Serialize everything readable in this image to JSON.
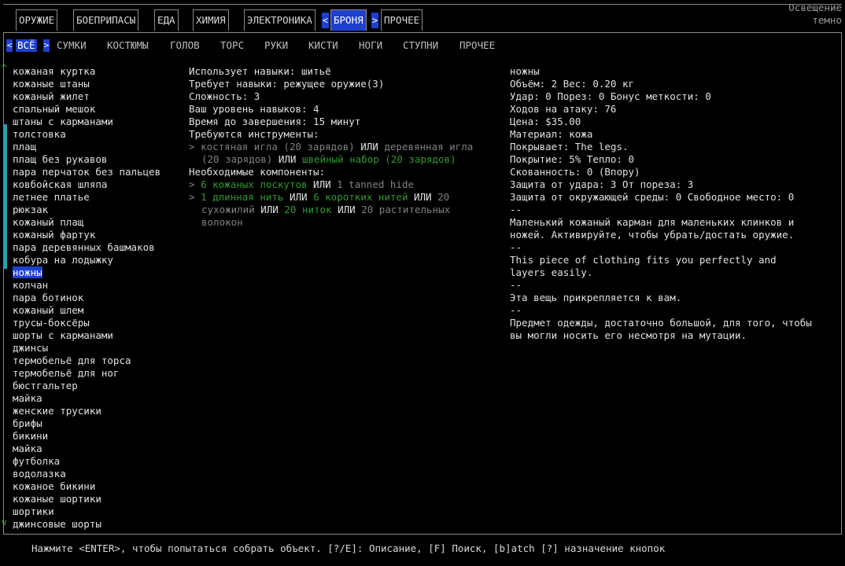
{
  "light": {
    "label": "Освещение",
    "value": "темно"
  },
  "tabs": [
    {
      "label": "ОРУЖИЕ",
      "active": false
    },
    {
      "label": "БОЕПРИПАСЫ",
      "active": false
    },
    {
      "label": "ЕДА",
      "active": false
    },
    {
      "label": "ХИМИЯ",
      "active": false
    },
    {
      "label": "ЭЛЕКТРОНИКА",
      "active": false
    },
    {
      "label": "БРОНЯ",
      "active": true
    },
    {
      "label": "ПРОЧЕЕ",
      "active": false
    }
  ],
  "subtabs": [
    {
      "label": "ВСЁ",
      "active": true
    },
    {
      "label": "СУМКИ",
      "active": false
    },
    {
      "label": "КОСТЮМЫ",
      "active": false
    },
    {
      "label": "ГОЛОВ",
      "active": false
    },
    {
      "label": "ТОРС",
      "active": false
    },
    {
      "label": "РУКИ",
      "active": false
    },
    {
      "label": "КИСТИ",
      "active": false
    },
    {
      "label": "НОГИ",
      "active": false
    },
    {
      "label": "СТУПНИ",
      "active": false
    },
    {
      "label": "ПРОЧЕЕ",
      "active": false
    }
  ],
  "items": [
    "кожаная куртка",
    "кожаные штаны",
    "кожаный жилет",
    "спальный мешок",
    "штаны с карманами",
    "толстовка",
    "плащ",
    "плащ без рукавов",
    "пара перчаток без пальцев",
    "ковбойская шляпа",
    "летнее платье",
    "рюкзак",
    "кожаный плащ",
    "кожаный фартук",
    "пара деревянных башмаков",
    "кобура на лодыжку",
    "ножны",
    "колчан",
    "пара ботинок",
    "кожаный шлем",
    "трусы-боксёры",
    "шорты с карманами",
    "джинсы",
    "термобельё для торса",
    "термобельё для ног",
    "бюстгальтер",
    "майка",
    "женские трусики",
    "брифы",
    "бикини",
    "майка",
    "футболка",
    "водолазка",
    "кожаное бикини",
    "кожаные шортики",
    "шортики",
    "джинсовые шорты"
  ],
  "selected_item": "ножны",
  "recipe": {
    "uses_skill": "Использует навыки: шитьё",
    "requires_skill": "Требует навыки: режущее оружие(3)",
    "difficulty": "Сложность: 3",
    "your_skill": "Ваш уровень навыков: 4",
    "time": "Время до завершения: 15 минут",
    "tools_header": "Требуются инструменты:",
    "tools": {
      "bullet": ">",
      "t1": "костяная игла (20 зарядов)",
      "or1": " ИЛИ ",
      "t2": "деревянная игла",
      "t2b": "(20 зарядов)",
      "or2": " ИЛИ ",
      "t3": "швейный набор (20 зарядов)"
    },
    "components_header": "Необходимые компоненты:",
    "comp1": {
      "bullet": ">",
      "a": "6 кожаных лоскутов",
      "or": " ИЛИ ",
      "b": "1 tanned hide"
    },
    "comp2": {
      "bullet": ">",
      "a": "1 длинная нить",
      "or1": " ИЛИ ",
      "b": "6 коротких нитей",
      "or2": " ИЛИ ",
      "c": "20",
      "c2": "сухожилий",
      "or3": " ИЛИ ",
      "d": "20 ниток",
      "or4": " ИЛИ ",
      "e": "20 растительных",
      "e2": "волокон"
    }
  },
  "description": [
    "ножны",
    "Объём: 2   Вес: 0.20 кг",
    "Удар: 0 Порез: 0 Бонус меткости: 0",
    "Ходов на атаку: 76",
    "Цена: $35.00",
    "Материал: кожа",
    "Покрывает: The legs.",
    "Покрытие: 5%  Тепло: 0",
    "Скованность: 0 (Впору)",
    "Защита от удара: 3   От пореза: 3",
    "Защита от окружающей среды: 0   Свободное место: 0",
    "--",
    "Маленький кожаный карман для маленьких клинков и",
    "ножей. Активируйте, чтобы убрать/достать оружие.",
    "--",
    "This piece of clothing fits you perfectly and",
    "layers easily.",
    "--",
    "Эта вещь прикрепляется к вам.",
    "--",
    "Предмет одежды, достаточно большой, для того, чтобы",
    "вы могли носить его несмотря на мутации."
  ],
  "footer": "Нажмите <ENTER>, чтобы попытаться собрать объект.  [?/E]: Описание, [F] Поиск, [b]atch [?] назначение кнопок",
  "icons": {
    "tab_left_arrow": "<",
    "tab_right_arrow": ">",
    "scroll_up": "^",
    "scroll_down": "v"
  },
  "colors": {
    "highlight": "#1f3fcf",
    "available": "#2f9a2f",
    "unavailable": "#808080",
    "scrollbar": "#27a0b5"
  }
}
